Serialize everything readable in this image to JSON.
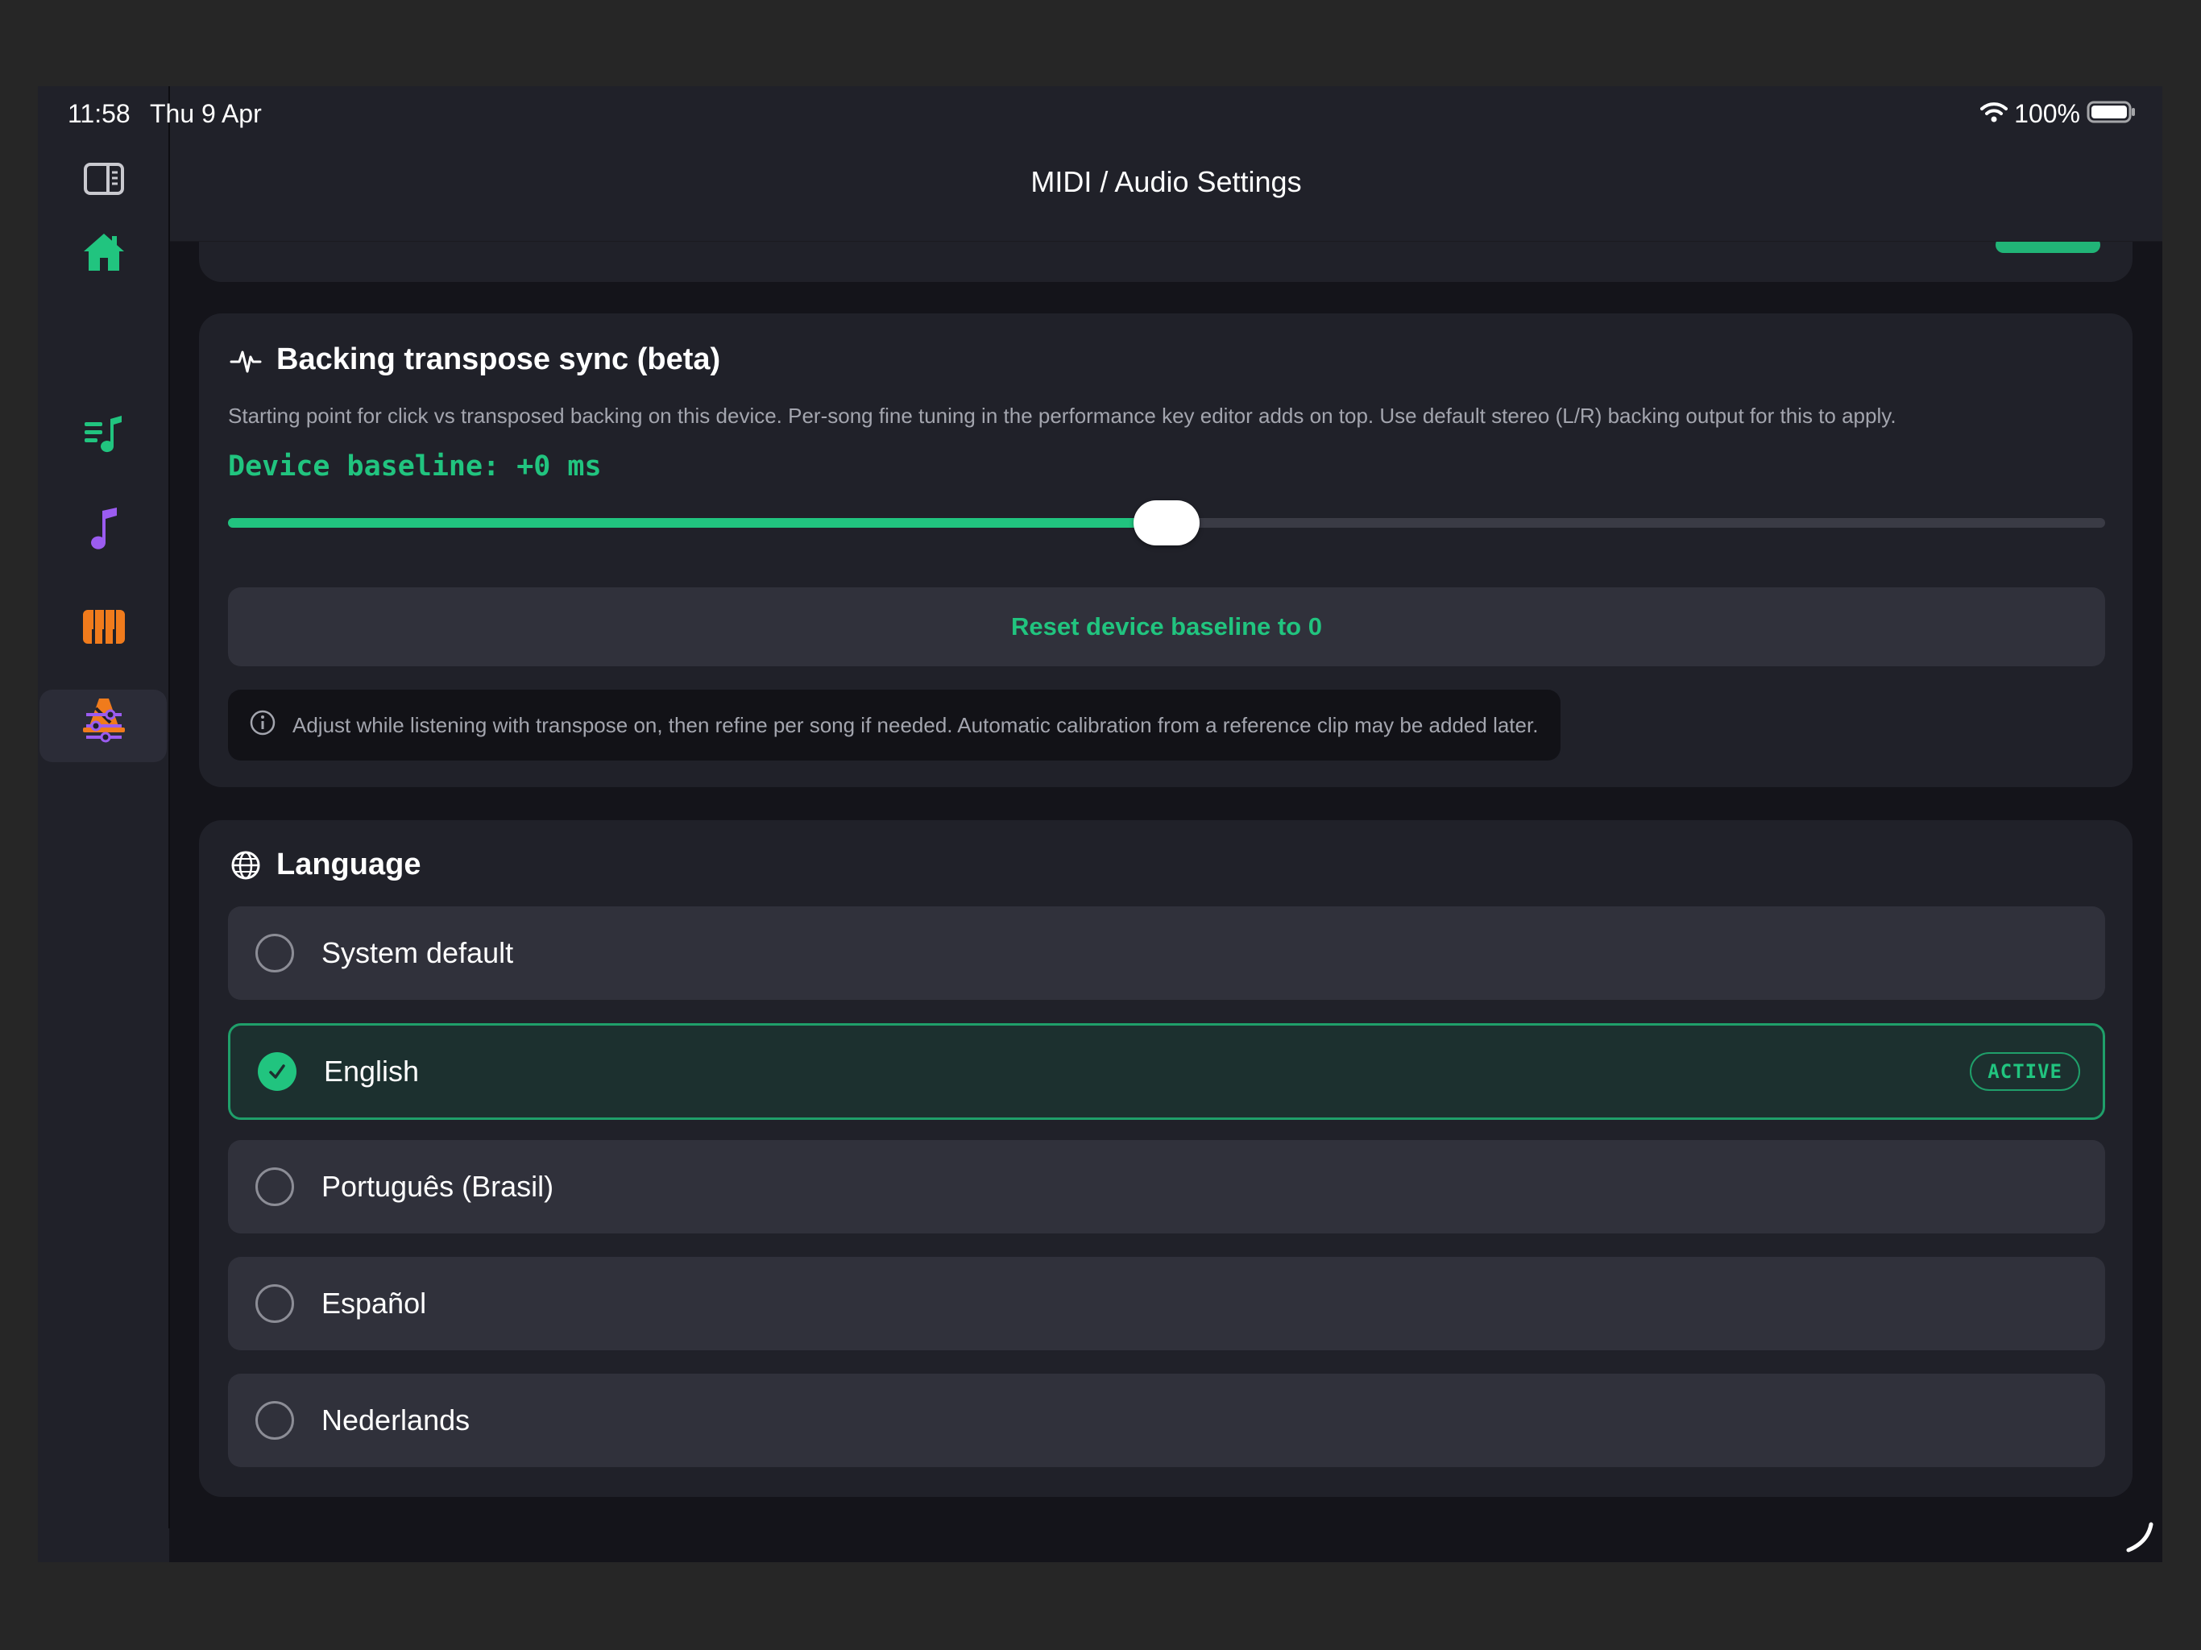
{
  "status_bar": {
    "time": "11:58",
    "date": "Thu 9 Apr",
    "battery": "100%"
  },
  "sidebar": {
    "items": [
      {
        "icon": "sidebar-toggle-icon",
        "color": "#c9c9cf"
      },
      {
        "icon": "home-icon",
        "color": "#21c47f"
      },
      {
        "icon": "playlist-icon",
        "color": "#21c47f"
      },
      {
        "icon": "music-note-icon",
        "color": "#9b5cf0"
      },
      {
        "icon": "piano-icon",
        "color": "#f07b1c"
      },
      {
        "icon": "metronome-icon",
        "color": "#f07b1c"
      },
      {
        "icon": "sliders-icon",
        "color": "#9b5cf0",
        "active": true
      }
    ]
  },
  "header": {
    "title": "MIDI / Audio Settings"
  },
  "sync": {
    "icon": "waveform-icon",
    "title": "Backing transpose sync (beta)",
    "description": "Starting point for click vs transposed backing on this device. Per-song fine tuning in the performance key editor adds on top. Use default stereo (L/R) backing output for this to apply.",
    "baseline_label": "Device baseline: +0 ms",
    "slider_fraction": 0.5,
    "reset_label": "Reset device baseline to 0",
    "info_icon": "info-icon",
    "info_text": "Adjust while listening with transpose on, then refine per song if needed. Automatic calibration from a reference clip may be added later."
  },
  "language": {
    "icon": "globe-icon",
    "title": "Language",
    "options": [
      {
        "label": "System default",
        "selected": false
      },
      {
        "label": "English",
        "selected": true,
        "badge": "ACTIVE"
      },
      {
        "label": "Português (Brasil)",
        "selected": false
      },
      {
        "label": "Español",
        "selected": false
      },
      {
        "label": "Nederlands",
        "selected": false
      }
    ]
  },
  "colors": {
    "accent": "#21c47f",
    "background": "#14141a",
    "card": "#202129",
    "row": "#30313b"
  }
}
